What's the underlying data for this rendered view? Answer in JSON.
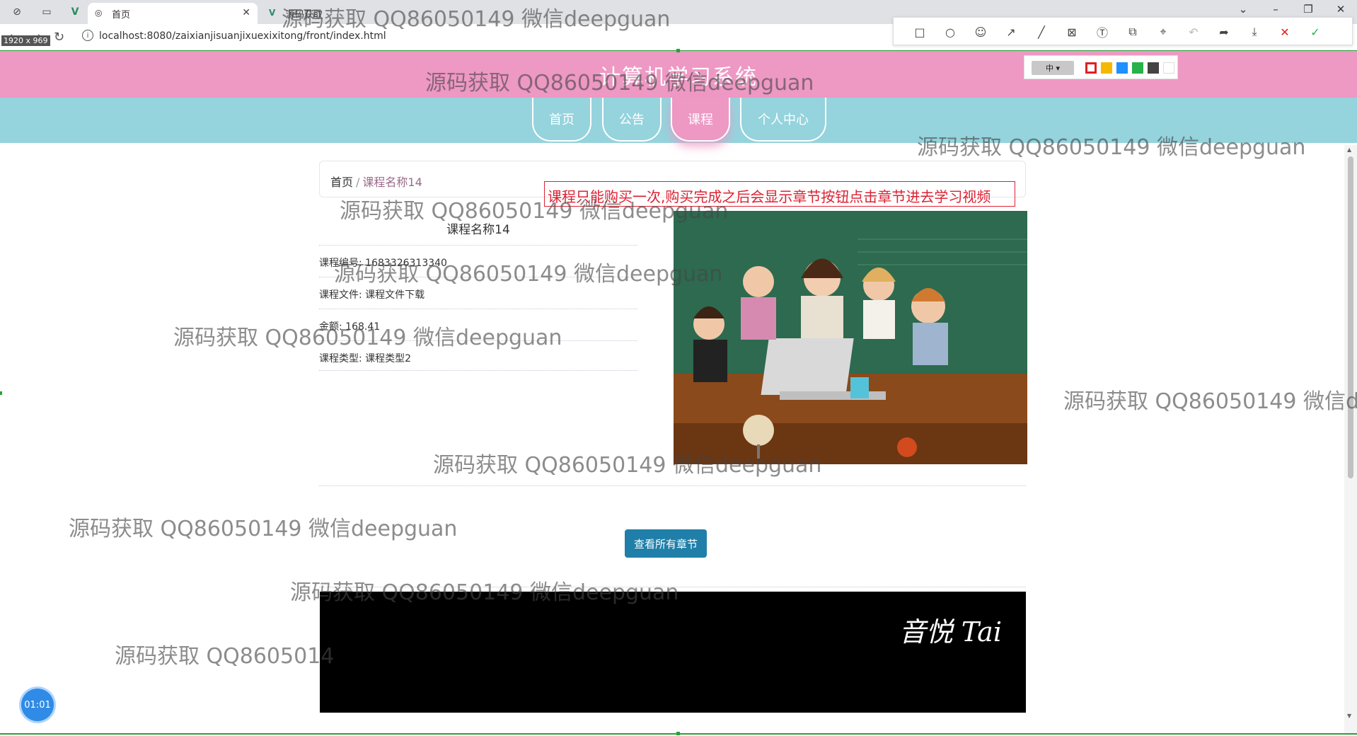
{
  "browser": {
    "tabs": [
      {
        "label": "首页",
        "active": true
      },
      {
        "label": "源码获取",
        "active": false
      }
    ],
    "url": "localhost:8080/zaixianjisuanjixuexixitong/front/index.html",
    "dimension_label": "1920 x 969"
  },
  "snap_toolbar": {
    "tools": [
      "rectangle-icon",
      "circle-icon",
      "emoji-icon",
      "arrow-icon",
      "line-icon",
      "mosaic-icon",
      "text-icon",
      "copy-icon",
      "pin-icon",
      "undo-icon",
      "share-icon",
      "download-icon",
      "close-icon",
      "confirm-icon"
    ],
    "size_label": "中",
    "swatch_colors": [
      "#e02020",
      "#f5b800",
      "#1e90ff",
      "#27b24a",
      "#444444",
      "#ffffff"
    ]
  },
  "site": {
    "title": "计算机学习系统",
    "nav": [
      {
        "label": "首页",
        "active": false
      },
      {
        "label": "公告",
        "active": false
      },
      {
        "label": "课程",
        "active": true
      },
      {
        "label": "个人中心",
        "active": false
      }
    ]
  },
  "breadcrumb": {
    "home": "首页",
    "separator": "/",
    "current": "课程名称14"
  },
  "notice": "课程只能购买一次,购买完成之后会显示章节按钮点击章节进去学习视频",
  "course": {
    "name": "课程名称14",
    "details": [
      "课程编号: 1683326313340",
      "课程文件: 课程文件下载",
      "金额: 168.41",
      "课程类型: 课程类型2"
    ]
  },
  "chapters_button": "查看所有章节",
  "video_logo": "音悦 Tai",
  "timer": "01:01",
  "watermark_text": "源码获取 QQ86050149 微信deepguan",
  "watermark_partial": "源码获取 QQ86050149 微信de",
  "watermark_partial2": "源码获取 QQ8605014"
}
